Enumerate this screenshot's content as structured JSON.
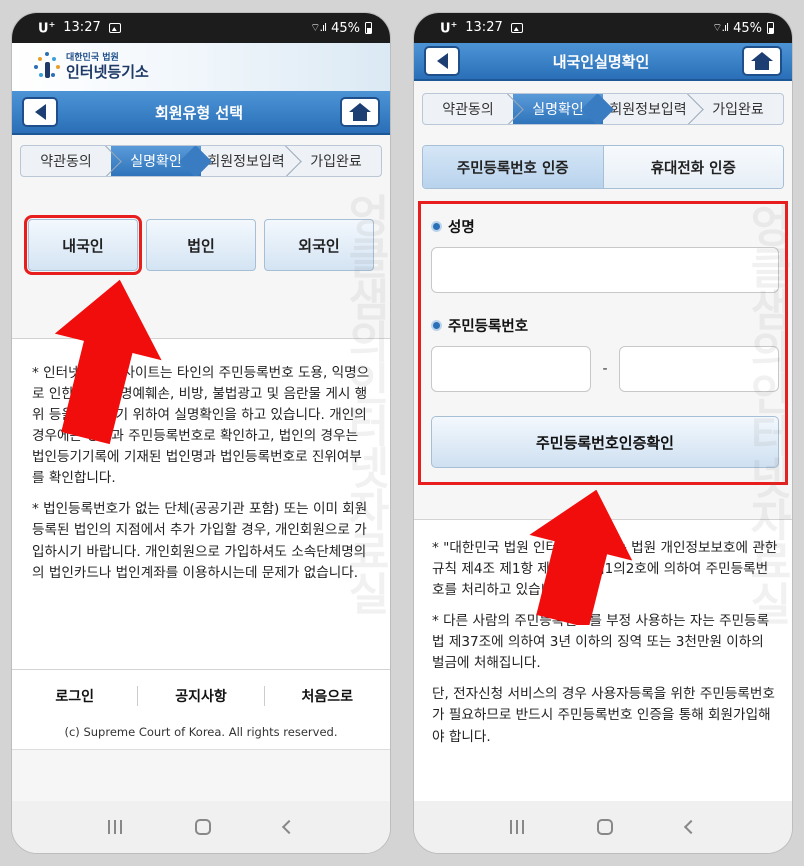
{
  "status": {
    "carrier": "U",
    "carrier_sup": "+",
    "time": "13:27",
    "battery": "45%",
    "signal": "⌔.ıl"
  },
  "logo": {
    "small": "대한민국 법원",
    "big": "인터넷등기소"
  },
  "left": {
    "title": "회원유형 선택",
    "steps": [
      "약관동의",
      "실명확인",
      "회원정보입력",
      "가입완료"
    ],
    "types": [
      "내국인",
      "법인",
      "외국인"
    ],
    "desc": [
      "* 인터넷등기소 사이트는 타인의 주민등록번호 도용, 익명으로 인한 타인의 명예훼손, 비방, 불법광고 및 음란물 게시 행위 등을 방지하기 위하여 실명확인을 하고 있습니다. 개인의 경우에는 성명과 주민등록번호로 확인하고, 법인의 경우는 법인등기기록에 기재된 법인명과 법인등록번호로 진위여부를 확인합니다.",
      "* 법인등록번호가 없는 단체(공공기관 포함) 또는 이미 회원등록된 법인의 지점에서 추가 가입할 경우, 개인회원으로 가입하시기 바랍니다. 개인회원으로 가입하셔도 소속단체명의의 법인카드나 법인계좌를 이용하시는데 문제가 없습니다."
    ],
    "footer": [
      "로그인",
      "공지사항",
      "처음으로"
    ],
    "copyright": "(c) Supreme Court of Korea. All rights reserved."
  },
  "right": {
    "title": "내국인실명확인",
    "steps": [
      "약관동의",
      "실명확인",
      "회원정보입력",
      "가입완료"
    ],
    "auth_tabs": [
      "주민등록번호 인증",
      "휴대전화 인증"
    ],
    "name_label": "성명",
    "ssn_label": "주민등록번호",
    "ssn_dash": "-",
    "confirm": "주민등록번호인증확인",
    "desc": [
      "* \"대한민국 법원 인터넷등기소\"는 법원 개인정보보호에 관한 규칙 제4조 제1항 제1호 및 제1의2호에 의하여 주민등록번호를 처리하고 있습니다.",
      "* 다른 사람의 주민등록번호를 부정 사용하는 자는 주민등록법 제37조에 의하여 3년 이하의 징역 또는 3천만원 이하의 벌금에 처해집니다.",
      "단, 전자신청 서비스의 경우 사용자등록을 위한 주민등록번호가 필요하므로 반드시 주민등록번호 인증을 통해 회원가입해야 합니다."
    ]
  },
  "watermark": "엉클샘의인터넷자료실",
  "colors": {
    "highlight": "#e81d1d",
    "nav": "#2a6fb7"
  }
}
